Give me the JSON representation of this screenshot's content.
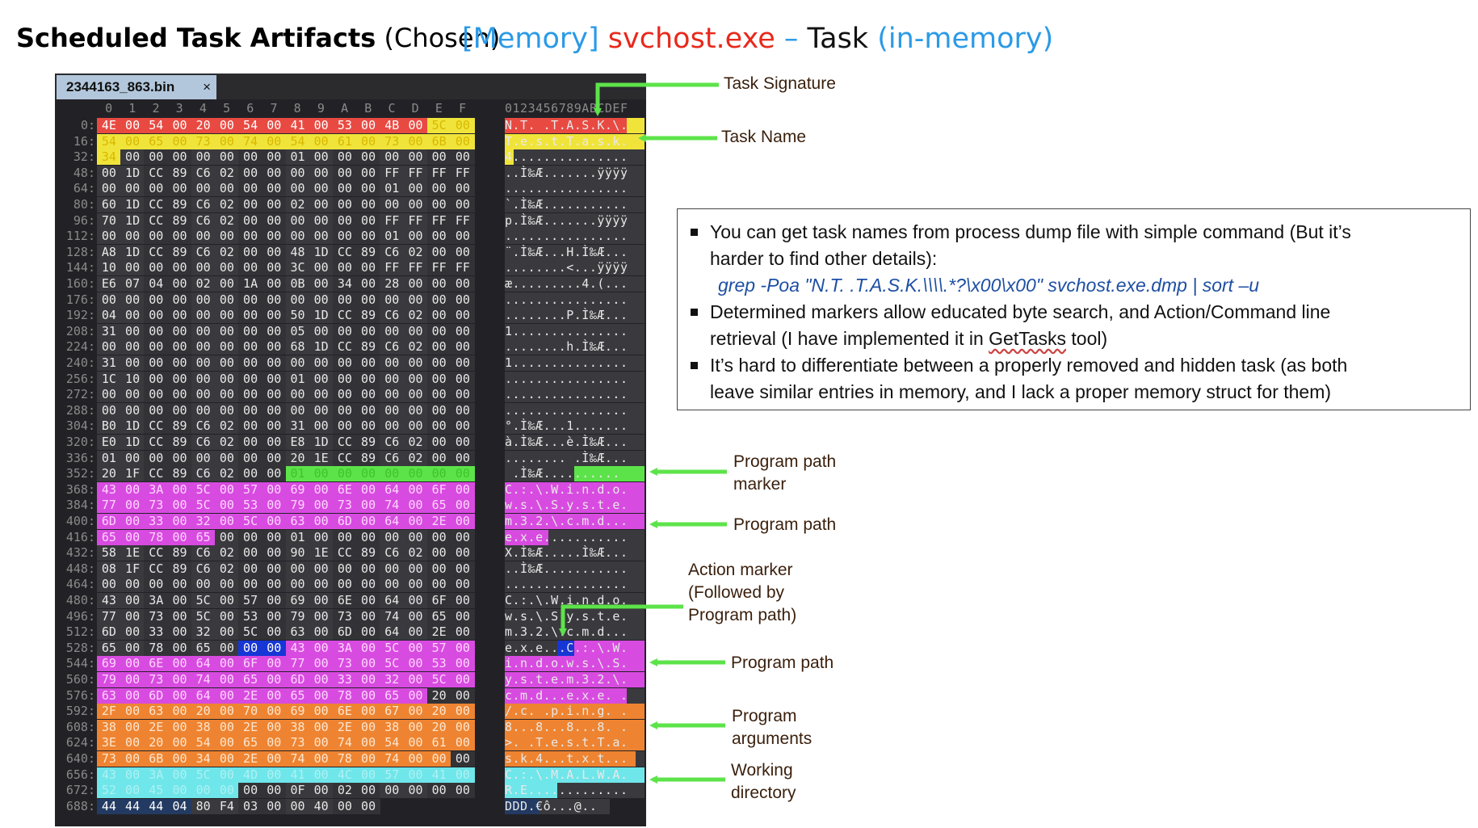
{
  "title_left": {
    "bold": "Scheduled Task Artifacts",
    "rest": " (Chosen)"
  },
  "title_right": {
    "memory": "[Memory]",
    "process": "svchost.exe",
    "dash": " – ",
    "task": "Task",
    "inmem": "(in-memory)",
    "colors": {
      "memory": "#2b9ae6",
      "process": "#e8291c",
      "task": "#111111",
      "inmem": "#2b9ae6"
    }
  },
  "hex_editor": {
    "tab_label": "2344163_863.bin",
    "tab_close": "×",
    "col_headers": [
      "0",
      "1",
      "2",
      "3",
      "4",
      "5",
      "6",
      "7",
      "8",
      "9",
      "A",
      "B",
      "C",
      "D",
      "E",
      "F"
    ],
    "ascii_header": "0123456789ABCDEF",
    "rows": [
      {
        "off": "0:",
        "bytes": [
          "4E",
          "00",
          "54",
          "00",
          "20",
          "00",
          "54",
          "00",
          "41",
          "00",
          "53",
          "00",
          "4B",
          "00",
          "5C",
          "00"
        ],
        "ascii": "N.T. .T.A.S.K.\\."
      },
      {
        "off": "16:",
        "bytes": [
          "54",
          "00",
          "65",
          "00",
          "73",
          "00",
          "74",
          "00",
          "54",
          "00",
          "61",
          "00",
          "73",
          "00",
          "6B",
          "00"
        ],
        "ascii": "T.e.s.t.T.a.s.k."
      },
      {
        "off": "32:",
        "bytes": [
          "34",
          "00",
          "00",
          "00",
          "00",
          "00",
          "00",
          "00",
          "01",
          "00",
          "00",
          "00",
          "00",
          "00",
          "00",
          "00"
        ],
        "ascii": "4..............."
      },
      {
        "off": "48:",
        "bytes": [
          "00",
          "1D",
          "CC",
          "89",
          "C6",
          "02",
          "00",
          "00",
          "00",
          "00",
          "00",
          "00",
          "FF",
          "FF",
          "FF",
          "FF"
        ],
        "ascii": "..Ì‰Æ.......ÿÿÿÿ"
      },
      {
        "off": "64:",
        "bytes": [
          "00",
          "00",
          "00",
          "00",
          "00",
          "00",
          "00",
          "00",
          "00",
          "00",
          "00",
          "00",
          "01",
          "00",
          "00",
          "00"
        ],
        "ascii": "................"
      },
      {
        "off": "80:",
        "bytes": [
          "60",
          "1D",
          "CC",
          "89",
          "C6",
          "02",
          "00",
          "00",
          "02",
          "00",
          "00",
          "00",
          "00",
          "00",
          "00",
          "00"
        ],
        "ascii": "`.Ì‰Æ..........."
      },
      {
        "off": "96:",
        "bytes": [
          "70",
          "1D",
          "CC",
          "89",
          "C6",
          "02",
          "00",
          "00",
          "00",
          "00",
          "00",
          "00",
          "FF",
          "FF",
          "FF",
          "FF"
        ],
        "ascii": "p.Ì‰Æ.......ÿÿÿÿ"
      },
      {
        "off": "112:",
        "bytes": [
          "00",
          "00",
          "00",
          "00",
          "00",
          "00",
          "00",
          "00",
          "00",
          "00",
          "00",
          "00",
          "01",
          "00",
          "00",
          "00"
        ],
        "ascii": "................"
      },
      {
        "off": "128:",
        "bytes": [
          "A8",
          "1D",
          "CC",
          "89",
          "C6",
          "02",
          "00",
          "00",
          "48",
          "1D",
          "CC",
          "89",
          "C6",
          "02",
          "00",
          "00"
        ],
        "ascii": "¨.Ì‰Æ...H.Ì‰Æ..."
      },
      {
        "off": "144:",
        "bytes": [
          "10",
          "00",
          "00",
          "00",
          "00",
          "00",
          "00",
          "00",
          "3C",
          "00",
          "00",
          "00",
          "FF",
          "FF",
          "FF",
          "FF"
        ],
        "ascii": "........<...ÿÿÿÿ"
      },
      {
        "off": "160:",
        "bytes": [
          "E6",
          "07",
          "04",
          "00",
          "02",
          "00",
          "1A",
          "00",
          "0B",
          "00",
          "34",
          "00",
          "28",
          "00",
          "00",
          "00"
        ],
        "ascii": "æ.........4.(..."
      },
      {
        "off": "176:",
        "bytes": [
          "00",
          "00",
          "00",
          "00",
          "00",
          "00",
          "00",
          "00",
          "00",
          "00",
          "00",
          "00",
          "00",
          "00",
          "00",
          "00"
        ],
        "ascii": "................"
      },
      {
        "off": "192:",
        "bytes": [
          "04",
          "00",
          "00",
          "00",
          "00",
          "00",
          "00",
          "00",
          "50",
          "1D",
          "CC",
          "89",
          "C6",
          "02",
          "00",
          "00"
        ],
        "ascii": "........P.Ì‰Æ..."
      },
      {
        "off": "208:",
        "bytes": [
          "31",
          "00",
          "00",
          "00",
          "00",
          "00",
          "00",
          "00",
          "05",
          "00",
          "00",
          "00",
          "00",
          "00",
          "00",
          "00"
        ],
        "ascii": "1..............."
      },
      {
        "off": "224:",
        "bytes": [
          "00",
          "00",
          "00",
          "00",
          "00",
          "00",
          "00",
          "00",
          "68",
          "1D",
          "CC",
          "89",
          "C6",
          "02",
          "00",
          "00"
        ],
        "ascii": "........h.Ì‰Æ..."
      },
      {
        "off": "240:",
        "bytes": [
          "31",
          "00",
          "00",
          "00",
          "00",
          "00",
          "00",
          "00",
          "00",
          "00",
          "00",
          "00",
          "00",
          "00",
          "00",
          "00"
        ],
        "ascii": "1..............."
      },
      {
        "off": "256:",
        "bytes": [
          "1C",
          "10",
          "00",
          "00",
          "00",
          "00",
          "00",
          "00",
          "01",
          "00",
          "00",
          "00",
          "00",
          "00",
          "00",
          "00"
        ],
        "ascii": "................"
      },
      {
        "off": "272:",
        "bytes": [
          "00",
          "00",
          "00",
          "00",
          "00",
          "00",
          "00",
          "00",
          "00",
          "00",
          "00",
          "00",
          "00",
          "00",
          "00",
          "00"
        ],
        "ascii": "................"
      },
      {
        "off": "288:",
        "bytes": [
          "00",
          "00",
          "00",
          "00",
          "00",
          "00",
          "00",
          "00",
          "00",
          "00",
          "00",
          "00",
          "00",
          "00",
          "00",
          "00"
        ],
        "ascii": "................"
      },
      {
        "off": "304:",
        "bytes": [
          "B0",
          "1D",
          "CC",
          "89",
          "C6",
          "02",
          "00",
          "00",
          "31",
          "00",
          "00",
          "00",
          "00",
          "00",
          "00",
          "00"
        ],
        "ascii": "°.Ì‰Æ...1......."
      },
      {
        "off": "320:",
        "bytes": [
          "E0",
          "1D",
          "CC",
          "89",
          "C6",
          "02",
          "00",
          "00",
          "E8",
          "1D",
          "CC",
          "89",
          "C6",
          "02",
          "00",
          "00"
        ],
        "ascii": "à.Ì‰Æ...è.Ì‰Æ..."
      },
      {
        "off": "336:",
        "bytes": [
          "01",
          "00",
          "00",
          "00",
          "00",
          "00",
          "00",
          "00",
          "20",
          "1E",
          "CC",
          "89",
          "C6",
          "02",
          "00",
          "00"
        ],
        "ascii": "........ .Ì‰Æ..."
      },
      {
        "off": "352:",
        "bytes": [
          "20",
          "1F",
          "CC",
          "89",
          "C6",
          "02",
          "00",
          "00",
          "01",
          "00",
          "00",
          "00",
          "00",
          "00",
          "00",
          "00"
        ],
        "ascii": " .Ì‰Æ.........."
      },
      {
        "off": "368:",
        "bytes": [
          "43",
          "00",
          "3A",
          "00",
          "5C",
          "00",
          "57",
          "00",
          "69",
          "00",
          "6E",
          "00",
          "64",
          "00",
          "6F",
          "00"
        ],
        "ascii": "C.:.\\.W.i.n.d.o."
      },
      {
        "off": "384:",
        "bytes": [
          "77",
          "00",
          "73",
          "00",
          "5C",
          "00",
          "53",
          "00",
          "79",
          "00",
          "73",
          "00",
          "74",
          "00",
          "65",
          "00"
        ],
        "ascii": "w.s.\\.S.y.s.t.e."
      },
      {
        "off": "400:",
        "bytes": [
          "6D",
          "00",
          "33",
          "00",
          "32",
          "00",
          "5C",
          "00",
          "63",
          "00",
          "6D",
          "00",
          "64",
          "00",
          "2E",
          "00"
        ],
        "ascii": "m.3.2.\\.c.m.d..."
      },
      {
        "off": "416:",
        "bytes": [
          "65",
          "00",
          "78",
          "00",
          "65",
          "00",
          "00",
          "00",
          "01",
          "00",
          "00",
          "00",
          "00",
          "00",
          "00",
          "00"
        ],
        "ascii": "e.x.e..........."
      },
      {
        "off": "432:",
        "bytes": [
          "58",
          "1E",
          "CC",
          "89",
          "C6",
          "02",
          "00",
          "00",
          "90",
          "1E",
          "CC",
          "89",
          "C6",
          "02",
          "00",
          "00"
        ],
        "ascii": "X.Ì‰Æ.....Ì‰Æ..."
      },
      {
        "off": "448:",
        "bytes": [
          "08",
          "1F",
          "CC",
          "89",
          "C6",
          "02",
          "00",
          "00",
          "00",
          "00",
          "00",
          "00",
          "00",
          "00",
          "00",
          "00"
        ],
        "ascii": "..Ì‰Æ..........."
      },
      {
        "off": "464:",
        "bytes": [
          "00",
          "00",
          "00",
          "00",
          "00",
          "00",
          "00",
          "00",
          "00",
          "00",
          "00",
          "00",
          "00",
          "00",
          "00",
          "00"
        ],
        "ascii": "................"
      },
      {
        "off": "480:",
        "bytes": [
          "43",
          "00",
          "3A",
          "00",
          "5C",
          "00",
          "57",
          "00",
          "69",
          "00",
          "6E",
          "00",
          "64",
          "00",
          "6F",
          "00"
        ],
        "ascii": "C.:.\\.W.i.n.d.o."
      },
      {
        "off": "496:",
        "bytes": [
          "77",
          "00",
          "73",
          "00",
          "5C",
          "00",
          "53",
          "00",
          "79",
          "00",
          "73",
          "00",
          "74",
          "00",
          "65",
          "00"
        ],
        "ascii": "w.s.\\.S.y.s.t.e."
      },
      {
        "off": "512:",
        "bytes": [
          "6D",
          "00",
          "33",
          "00",
          "32",
          "00",
          "5C",
          "00",
          "63",
          "00",
          "6D",
          "00",
          "64",
          "00",
          "2E",
          "00"
        ],
        "ascii": "m.3.2.\\.c.m.d..."
      },
      {
        "off": "528:",
        "bytes": [
          "65",
          "00",
          "78",
          "00",
          "65",
          "00",
          "00",
          "00",
          "43",
          "00",
          "3A",
          "00",
          "5C",
          "00",
          "57",
          "00"
        ],
        "ascii": "e.x.e...C.:.\\.W."
      },
      {
        "off": "544:",
        "bytes": [
          "69",
          "00",
          "6E",
          "00",
          "64",
          "00",
          "6F",
          "00",
          "77",
          "00",
          "73",
          "00",
          "5C",
          "00",
          "53",
          "00"
        ],
        "ascii": "i.n.d.o.w.s.\\.S."
      },
      {
        "off": "560:",
        "bytes": [
          "79",
          "00",
          "73",
          "00",
          "74",
          "00",
          "65",
          "00",
          "6D",
          "00",
          "33",
          "00",
          "32",
          "00",
          "5C",
          "00"
        ],
        "ascii": "y.s.t.e.m.3.2.\\."
      },
      {
        "off": "576:",
        "bytes": [
          "63",
          "00",
          "6D",
          "00",
          "64",
          "00",
          "2E",
          "00",
          "65",
          "00",
          "78",
          "00",
          "65",
          "00",
          "20",
          "00"
        ],
        "ascii": "c.m.d...e.x.e. ."
      },
      {
        "off": "592:",
        "bytes": [
          "2F",
          "00",
          "63",
          "00",
          "20",
          "00",
          "70",
          "00",
          "69",
          "00",
          "6E",
          "00",
          "67",
          "00",
          "20",
          "00"
        ],
        "ascii": "/.c. .p.i.n.g. ."
      },
      {
        "off": "608:",
        "bytes": [
          "38",
          "00",
          "2E",
          "00",
          "38",
          "00",
          "2E",
          "00",
          "38",
          "00",
          "2E",
          "00",
          "38",
          "00",
          "20",
          "00"
        ],
        "ascii": "8...8...8...8. ."
      },
      {
        "off": "624:",
        "bytes": [
          "3E",
          "00",
          "20",
          "00",
          "54",
          "00",
          "65",
          "00",
          "73",
          "00",
          "74",
          "00",
          "54",
          "00",
          "61",
          "00"
        ],
        "ascii": ">. .T.e.s.t.T.a."
      },
      {
        "off": "640:",
        "bytes": [
          "73",
          "00",
          "6B",
          "00",
          "34",
          "00",
          "2E",
          "00",
          "74",
          "00",
          "78",
          "00",
          "74",
          "00",
          "00",
          "00"
        ],
        "ascii": "s.k.4...t.x.t..."
      },
      {
        "off": "656:",
        "bytes": [
          "43",
          "00",
          "3A",
          "00",
          "5C",
          "00",
          "4D",
          "00",
          "41",
          "00",
          "4C",
          "00",
          "57",
          "00",
          "41",
          "00"
        ],
        "ascii": "C.:.\\.M.A.L.W.A."
      },
      {
        "off": "672:",
        "bytes": [
          "52",
          "00",
          "45",
          "00",
          "00",
          "00",
          "00",
          "00",
          "0F",
          "00",
          "02",
          "00",
          "00",
          "00",
          "00",
          "00"
        ],
        "ascii": "R.E............."
      },
      {
        "off": "688:",
        "bytes": [
          "44",
          "44",
          "44",
          "04",
          "80",
          "F4",
          "03",
          "00",
          "00",
          "40",
          "00",
          "00",
          "",
          "",
          "",
          ""
        ],
        "ascii": "DDD.€ô...@.."
      }
    ],
    "highlight_colors": {
      "red": "#e84a42",
      "yellow": "#f0e43a",
      "green": "#5de34a",
      "magenta": "#d84be0",
      "blue": "#1736d6",
      "orange": "#ee8431",
      "cyan": "#6fe6ea",
      "navy": "#233a62"
    }
  },
  "annotations": {
    "task_signature": "Task Signature",
    "task_name": "Task Name",
    "program_path_marker": [
      "Program path",
      "marker"
    ],
    "program_path_1": "Program path",
    "action_marker": [
      "Action marker",
      "(Followed by",
      "Program path)"
    ],
    "program_path_2": "Program path",
    "program_arguments": [
      "Program",
      "arguments"
    ],
    "working_directory": [
      "Working",
      "directory"
    ],
    "arrow_color": "#5de34a"
  },
  "notes": {
    "item1_line1": "You can get task names from process dump file with simple command (But it’s",
    "item1_line2": "harder to find other details):",
    "command": "grep -Poa \"N.T. .T.A.S.K.\\\\\\\\.*?\\x00\\x00\" svchost.exe.dmp | sort –u",
    "item2_line1": "Determined markers allow educated byte search, and Action/Command line",
    "item2_line2_a": "retrieval (I have implemented it in ",
    "item2_tool": "GetTasks",
    "item2_line2_b": " tool)",
    "item3_line1": "It’s hard to differentiate between a properly removed and hidden task (as both",
    "item3_line2": "leave similar entries in memory, and I lack a proper memory struct for them)"
  }
}
